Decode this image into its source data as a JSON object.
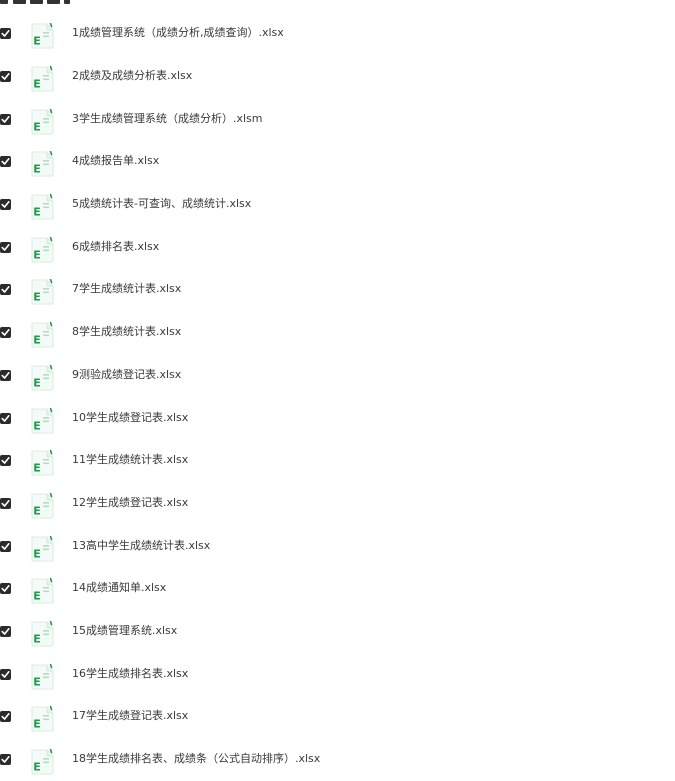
{
  "files": [
    {
      "name": "1成绩管理系统（成绩分析,成绩查询）.xlsx",
      "checked": true,
      "icon": "excel-file-icon"
    },
    {
      "name": "2成绩及成绩分析表.xlsx",
      "checked": true,
      "icon": "excel-file-icon"
    },
    {
      "name": "3学生成绩管理系统（成绩分析）.xlsm",
      "checked": true,
      "icon": "excel-file-icon"
    },
    {
      "name": "4成绩报告单.xlsx",
      "checked": true,
      "icon": "excel-file-icon"
    },
    {
      "name": "5成绩统计表-可查询、成绩统计.xlsx",
      "checked": true,
      "icon": "excel-file-icon"
    },
    {
      "name": "6成绩排名表.xlsx",
      "checked": true,
      "icon": "excel-file-icon"
    },
    {
      "name": "7学生成绩统计表.xlsx",
      "checked": true,
      "icon": "excel-file-icon"
    },
    {
      "name": "8学生成绩统计表.xlsx",
      "checked": true,
      "icon": "excel-file-icon"
    },
    {
      "name": "9测验成绩登记表.xlsx",
      "checked": true,
      "icon": "excel-file-icon"
    },
    {
      "name": "10学生成绩登记表.xlsx",
      "checked": true,
      "icon": "excel-file-icon"
    },
    {
      "name": "11学生成绩统计表.xlsx",
      "checked": true,
      "icon": "excel-file-icon"
    },
    {
      "name": "12学生成绩登记表.xlsx",
      "checked": true,
      "icon": "excel-file-icon"
    },
    {
      "name": "13高中学生成绩统计表.xlsx",
      "checked": true,
      "icon": "excel-file-icon"
    },
    {
      "name": "14成绩通知单.xlsx",
      "checked": true,
      "icon": "excel-file-icon"
    },
    {
      "name": "15成绩管理系统.xlsx",
      "checked": true,
      "icon": "excel-file-icon"
    },
    {
      "name": "16学生成绩排名表.xlsx",
      "checked": true,
      "icon": "excel-file-icon"
    },
    {
      "name": "17学生成绩登记表.xlsx",
      "checked": true,
      "icon": "excel-file-icon"
    },
    {
      "name": "18学生成绩排名表、成绩条（公式自动排序）.xlsx",
      "checked": true,
      "icon": "excel-file-icon"
    }
  ],
  "colors": {
    "excel_green": "#1d9b52",
    "checkbox_fill": "#2b2b2b"
  }
}
